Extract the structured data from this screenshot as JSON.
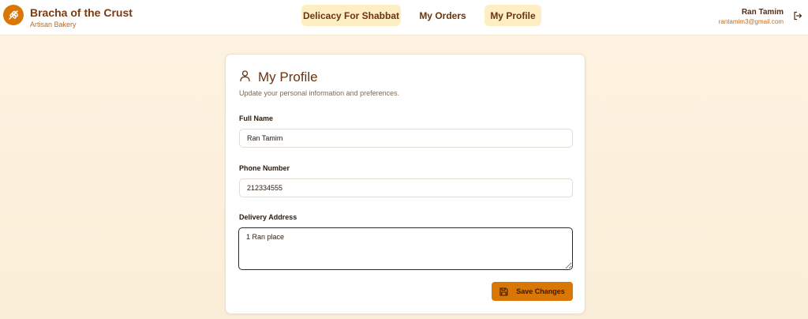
{
  "brand": {
    "title": "Bracha of the Crust",
    "subtitle": "Artisan Bakery",
    "logo_icon": "wheat-icon",
    "accent_color": "#d97706"
  },
  "nav": {
    "items": [
      {
        "label": "Delicacy For Shabbat",
        "active": true
      },
      {
        "label": "My Orders",
        "active": false
      },
      {
        "label": "My Profile",
        "active": true
      }
    ]
  },
  "user": {
    "name": "Ran Tamim",
    "email": "rantamim3@gmail.com",
    "logout_icon": "logout-icon"
  },
  "profile": {
    "title": "My Profile",
    "subtitle": "Update your personal information and preferences.",
    "icon": "user-icon",
    "fields": {
      "full_name": {
        "label": "Full Name",
        "value": "Ran Tamim"
      },
      "phone": {
        "label": "Phone Number",
        "value": "212334555"
      },
      "address": {
        "label": "Delivery Address",
        "value": "1 Ran place"
      }
    },
    "save_label": "Save Changes",
    "save_icon": "save-icon"
  }
}
